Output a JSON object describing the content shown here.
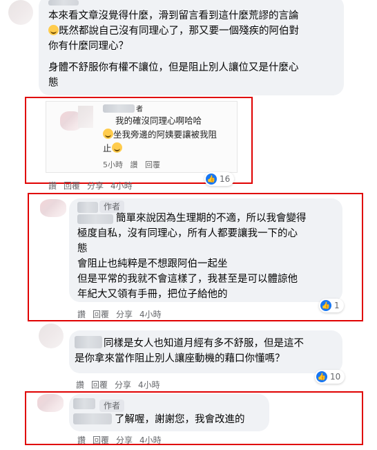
{
  "comment1": {
    "paragraph1": "本來看文章沒覺得什麼，滑到留言看到這什麼荒謬的言論",
    "paragraph1_line2": "既然都說自己沒有同理心了，那又要一個殘疾的阿伯對",
    "paragraph1_line3": "你有什麼同理心？",
    "paragraph2_line1": "身體不舒服你有權不讓位，但是阻止別人讓位又是什麼心",
    "paragraph2_line2": "態"
  },
  "embedded_shot": {
    "author_suffix": "者",
    "line1": "我的確沒同理心啊哈哈",
    "line2": "坐我旁邊的阿姨要讓被我阻",
    "line3": "止",
    "time": "5小時",
    "like": "讚",
    "reply": "回覆"
  },
  "comment1_actions": {
    "like": "讚",
    "reply": "回覆",
    "share": "分享",
    "time": "4小時",
    "reactions": "16"
  },
  "comment2": {
    "badge": "作者",
    "line1": "簡單來說因為生理期的不適，所以我會變得",
    "line2": "極度自私，沒有同理心，所有人都要讓我一下的心",
    "line3": "態",
    "line4": "會阻止也純粹是不想跟阿伯一起坐",
    "line5": "但是平常的我就不會這樣了，我甚至是可以體諒他",
    "line6": "年紀大又領有手冊，把位子給他的",
    "actions": {
      "like": "讚",
      "reply": "回覆",
      "share": "分享",
      "time": "4小時",
      "reactions": "1"
    }
  },
  "comment3": {
    "line1": "同樣是女人也知道月經有多不舒服，但是這不",
    "line2": "是你拿來當作阻止別人讓座動機的藉口你懂嗎？",
    "actions": {
      "like": "讚",
      "reply": "回覆",
      "share": "分享",
      "time": "4小時",
      "reactions": "10"
    }
  },
  "comment4": {
    "badge": "作者",
    "text": "了解喔，謝謝您，我會改進的",
    "actions": {
      "like": "讚",
      "reply": "回覆",
      "share": "分享",
      "time": "4小時"
    }
  },
  "colors": {
    "highlight_border": "#e00000",
    "bubble": "#f0f2f5",
    "like_blue": "#1877f2"
  }
}
